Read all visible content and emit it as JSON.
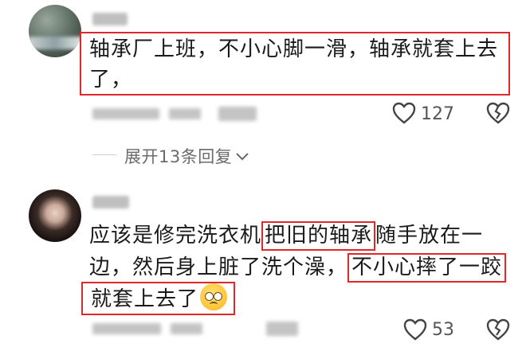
{
  "comments": [
    {
      "line1": "轴承厂上班，不小心脚一滑，轴承就套上去",
      "line2": "了，",
      "likes": "127"
    },
    {
      "line1_a": "应该是修完洗衣机",
      "line1_b": "把旧的轴承",
      "line1_c": "随手放在一",
      "line2_a": "边，然后身上脏了洗个澡，",
      "line2_b": "不小心摔了一跤",
      "line3": "就套上去了",
      "emoji": "pleading-face-emoji",
      "likes": "53"
    }
  ],
  "replies_toggle": "展开13条回复",
  "icons": {
    "like": "heart-outline-icon",
    "dislike": "broken-heart-icon",
    "expand": "chevron-down-icon"
  },
  "colors": {
    "highlight": "#e0272a",
    "text": "#1a1a1a",
    "muted": "#6b6b6b"
  }
}
